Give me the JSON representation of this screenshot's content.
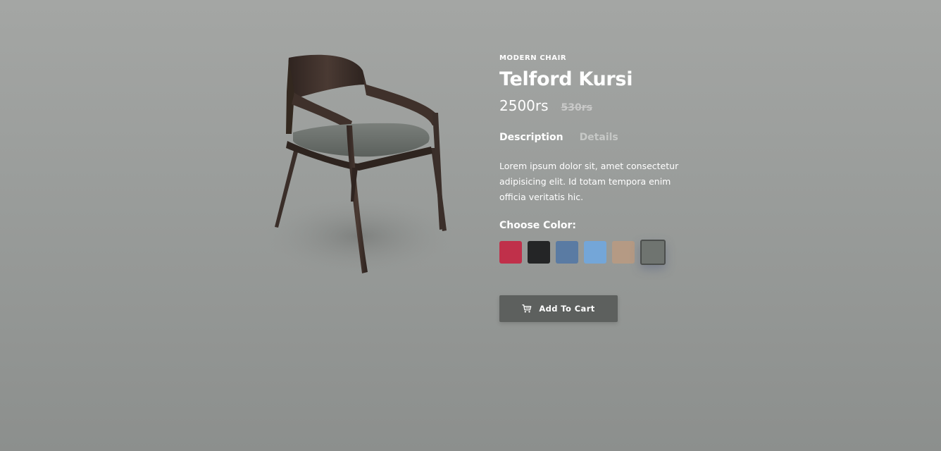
{
  "product": {
    "category": "MODERN CHAIR",
    "name": "Telford Kursi",
    "price_current": "2500rs",
    "price_old": "530rs"
  },
  "tabs": [
    {
      "label": "Description",
      "active": true
    },
    {
      "label": "Details",
      "active": false
    }
  ],
  "description": "Lorem ipsum dolor sit, amet consectetur adipisicing elit. Id totam tempora enim officia veritatis hic.",
  "color_picker": {
    "label": "Choose Color:",
    "swatches": [
      {
        "color": "#c0304a",
        "selected": false
      },
      {
        "color": "#242526",
        "selected": false
      },
      {
        "color": "#5a7ba3",
        "selected": false
      },
      {
        "color": "#74a6d8",
        "selected": false
      },
      {
        "color": "#b59a84",
        "selected": false
      },
      {
        "color": "#6f7470",
        "selected": true
      }
    ]
  },
  "cart_button": {
    "label": "Add To Cart",
    "icon": "cart-icon"
  },
  "image": {
    "icon": "chair-product-image",
    "seat_color": "#6f7470",
    "frame_color": "#3e302b"
  }
}
